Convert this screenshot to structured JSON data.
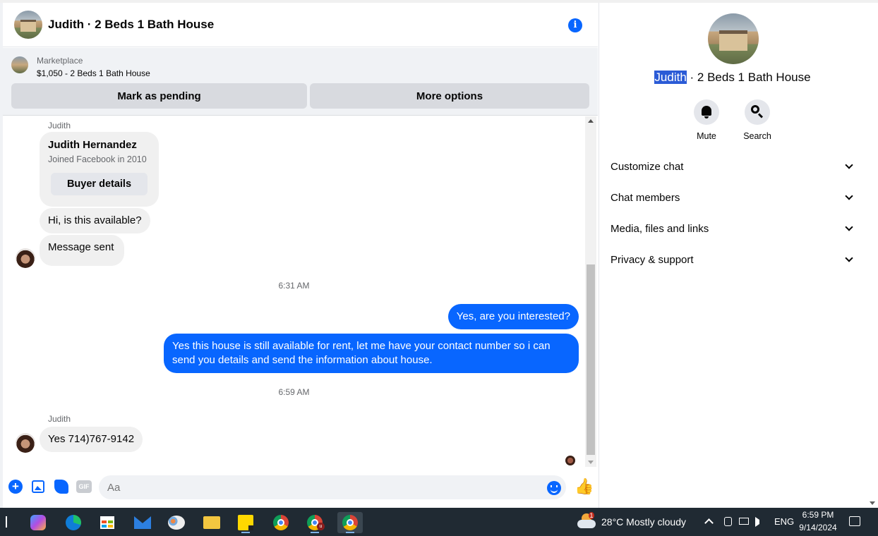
{
  "chat": {
    "title": "Judith · 2 Beds 1 Bath House",
    "marketplace": {
      "kind": "Marketplace",
      "listing": "$1,050 - 2 Beds 1 Bath House",
      "pending_label": "Mark as pending",
      "more_label": "More options"
    },
    "messages": {
      "sender1": "Judith",
      "card_name": "Judith Hernandez",
      "card_sub": "Joined Facebook in 2010",
      "card_button": "Buyer details",
      "m1": "Hi, is this available?",
      "m2": "Message sent",
      "ts1": "6:31 AM",
      "m3": "Yes, are you interested?",
      "m4": "Yes this house is still available for rent, let me have your contact number so i can send you details and send the information about house.",
      "ts2": "6:59 AM",
      "sender2": "Judith",
      "m5": "Yes 714)767-9142"
    },
    "composer": {
      "placeholder": "Aa",
      "gif_label": "GIF"
    }
  },
  "info": {
    "title_highlight": "Judith",
    "title_rest": " · 2 Beds 1 Bath House",
    "mute_label": "Mute",
    "search_label": "Search",
    "sections": [
      "Customize chat",
      "Chat members",
      "Media, files and links",
      "Privacy & support"
    ]
  },
  "taskbar": {
    "weather": "28°C  Mostly cloudy",
    "weather_badge": "1",
    "lang": "ENG",
    "time": "6:59 PM",
    "date": "9/14/2024",
    "badge_u": "u"
  },
  "colors": {
    "accent": "#0866ff",
    "taskbar": "#202a33"
  }
}
